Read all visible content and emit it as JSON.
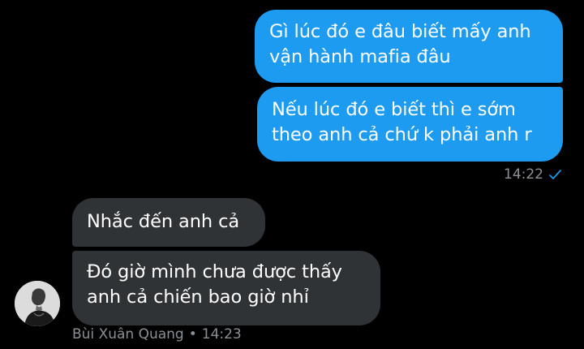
{
  "outgoing": {
    "messages": [
      {
        "line1": "Gì lúc đó e đâu biết mấy anh",
        "line2": "vận hành mafia đâu"
      },
      {
        "line1": "Nếu lúc đó e biết thì e sớm",
        "line2": "theo anh cả chứ k phải anh r"
      }
    ],
    "time": "14:22",
    "status_icon": "check-icon",
    "accent_color": "#1d9bf0"
  },
  "incoming": {
    "messages": [
      {
        "line1": "Nhắc đến anh cả"
      },
      {
        "line1": "Đó giờ mình chưa được thấy",
        "line2": "anh cả chiến bao giờ nhỉ"
      }
    ],
    "sender_name": "Bùi Xuân Quang",
    "separator": "•",
    "time": "14:23",
    "bubble_color": "#2f3336"
  }
}
